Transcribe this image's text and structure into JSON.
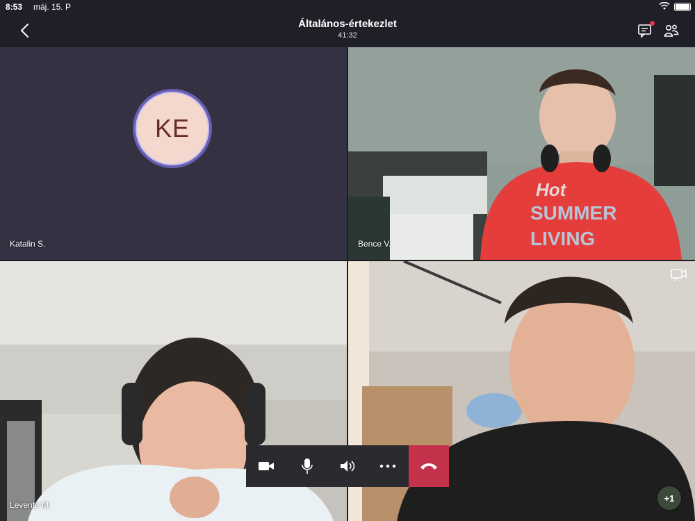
{
  "status_bar": {
    "time": "8:53",
    "date": "máj. 15. P"
  },
  "meeting": {
    "title": "Általános-értekezlet",
    "duration": "41:32"
  },
  "participants": [
    {
      "name": "Katalin S.",
      "initials": "KE",
      "avatar_color": "#f4d7cd",
      "ring_color": "#6860b3",
      "video": false
    },
    {
      "name": "Bence V.",
      "video": true
    },
    {
      "name": "Levente M.",
      "video": true
    },
    {
      "name": "",
      "video": true
    }
  ],
  "controls": [
    {
      "id": "camera",
      "icon": "video-camera-icon"
    },
    {
      "id": "mic",
      "icon": "microphone-icon"
    },
    {
      "id": "speaker",
      "icon": "speaker-icon"
    },
    {
      "id": "more",
      "icon": "more-options-icon"
    },
    {
      "id": "hangup",
      "icon": "hang-up-icon",
      "color": "#c4314b"
    }
  ],
  "overflow": {
    "label": "+1"
  },
  "colors": {
    "header_bg": "#1f1f27",
    "tile_bg": "#343143",
    "hangup": "#c4314b",
    "notification": "#e6334a"
  }
}
